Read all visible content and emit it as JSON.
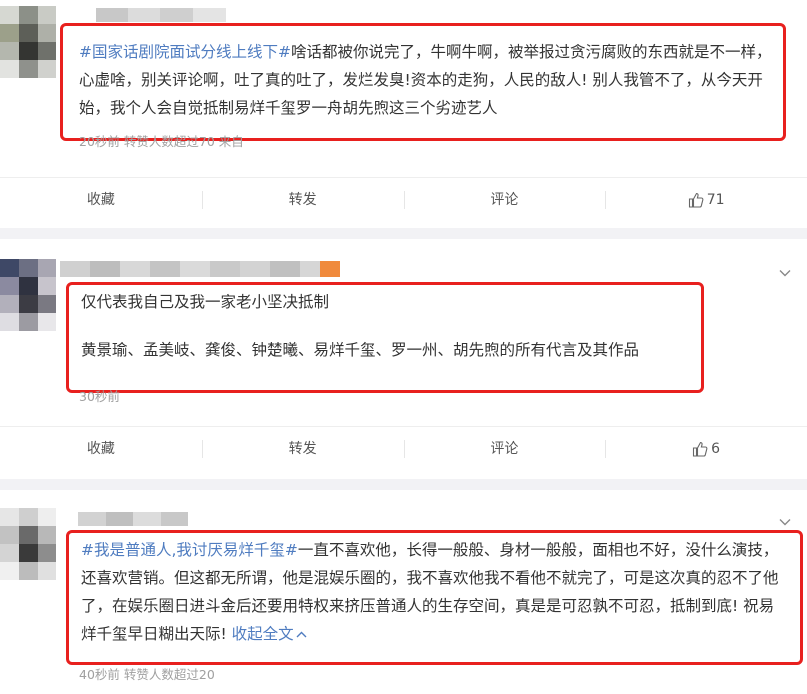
{
  "posts": [
    {
      "hashtag": "#国家话剧院面试分线上线下#",
      "text": "啥话都被你说完了，牛啊牛啊，被举报过贪污腐败的东西就是不一样，心虚啥，别关评论啊，吐了真的吐了，发烂发臭!资本的走狗，人民的敌人! 别人我管不了，从今天开始，我个人会自觉抵制易烊千玺罗一舟胡先煦这三个劣迹艺人",
      "meta": "20秒前  转赞人数超过70  来自",
      "actions": {
        "collect": "收藏",
        "repost": "转发",
        "comment": "评论",
        "likes": "71"
      }
    },
    {
      "line1": "仅代表我自己及我一家老小坚决抵制",
      "line2": "黄景瑜、孟美岐、龚俊、钟楚曦、易烊千玺、罗一州、胡先煦的所有代言及其作品",
      "meta": "30秒前",
      "actions": {
        "collect": "收藏",
        "repost": "转发",
        "comment": "评论",
        "likes": "6"
      }
    },
    {
      "hashtag": "#我是普通人,我讨厌易烊千玺#",
      "text": "一直不喜欢他，长得一般般、身材一般般，面相也不好，没什么演技，还喜欢营销。但这都无所谓，他是混娱乐圈的，我不喜欢他我不看他不就完了，可是这次真的忍不了他了，在娱乐圈日进斗金后还要用特权来挤压普通人的生存空间，真是是可忍孰不可忍，抵制到底! 祝易烊千玺早日糊出天际!",
      "collapse": "收起全文",
      "meta": "40秒前  转赞人数超过20"
    }
  ],
  "colors": {
    "highlight_border": "#e8201e",
    "link": "#4f7cc0"
  }
}
